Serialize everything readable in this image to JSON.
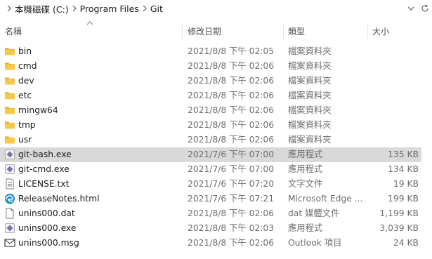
{
  "address": {
    "crumbs": [
      "本機磁碟 (C:)",
      "Program Files",
      "Git"
    ]
  },
  "columns": {
    "name": "名稱",
    "date": "修改日期",
    "type": "類型",
    "size": "大小"
  },
  "files": [
    {
      "name": "bin",
      "date": "2021/8/8 下午 02:05",
      "type": "檔案資料夾",
      "size": "",
      "icon": "folder-icon"
    },
    {
      "name": "cmd",
      "date": "2021/8/8 下午 02:06",
      "type": "檔案資料夾",
      "size": "",
      "icon": "folder-icon"
    },
    {
      "name": "dev",
      "date": "2021/8/8 下午 02:06",
      "type": "檔案資料夾",
      "size": "",
      "icon": "folder-icon"
    },
    {
      "name": "etc",
      "date": "2021/8/8 下午 02:06",
      "type": "檔案資料夾",
      "size": "",
      "icon": "folder-icon"
    },
    {
      "name": "mingw64",
      "date": "2021/8/8 下午 02:06",
      "type": "檔案資料夾",
      "size": "",
      "icon": "folder-icon"
    },
    {
      "name": "tmp",
      "date": "2021/8/8 下午 02:06",
      "type": "檔案資料夾",
      "size": "",
      "icon": "folder-icon"
    },
    {
      "name": "usr",
      "date": "2021/8/8 下午 02:06",
      "type": "檔案資料夾",
      "size": "",
      "icon": "folder-icon"
    },
    {
      "name": "git-bash.exe",
      "date": "2021/7/6 下午 07:00",
      "type": "應用程式",
      "size": "135 KB",
      "icon": "git-icon"
    },
    {
      "name": "git-cmd.exe",
      "date": "2021/7/6 下午 07:00",
      "type": "應用程式",
      "size": "134 KB",
      "icon": "git-icon"
    },
    {
      "name": "LICENSE.txt",
      "date": "2021/7/6 下午 07:20",
      "type": "文字文件",
      "size": "19 KB",
      "icon": "text-file-icon"
    },
    {
      "name": "ReleaseNotes.html",
      "date": "2021/7/6 下午 07:21",
      "type": "Microsoft Edge ...",
      "size": "199 KB",
      "icon": "edge-icon"
    },
    {
      "name": "unins000.dat",
      "date": "2021/8/8 下午 02:06",
      "type": "dat 媒體文件",
      "size": "1,199 KB",
      "icon": "blank-file-icon"
    },
    {
      "name": "unins000.exe",
      "date": "2021/8/8 下午 02:03",
      "type": "應用程式",
      "size": "3,039 KB",
      "icon": "git-icon"
    },
    {
      "name": "unins000.msg",
      "date": "2021/8/8 下午 02:06",
      "type": "Outlook 項目",
      "size": "24 KB",
      "icon": "mail-icon"
    }
  ],
  "selected_row": "git-bash.exe",
  "colors": {
    "folder": "#f7c948",
    "selection": "#d9d9d9",
    "edge": "#1a8ad4",
    "git_blue": "#5b7fd6",
    "git_red": "#e3453b"
  }
}
